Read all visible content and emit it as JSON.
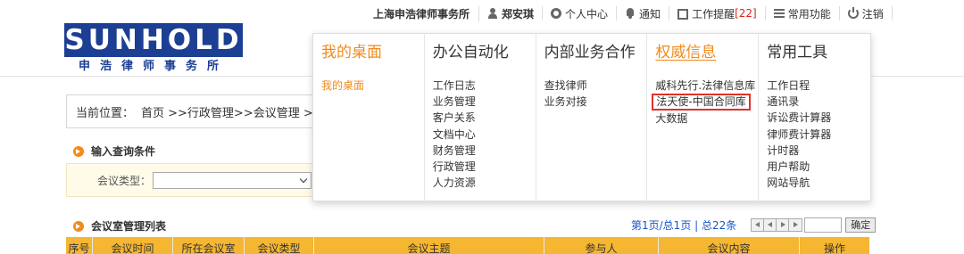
{
  "header": {
    "logo_text": "SUNHOLD",
    "logo_sub": "申浩律师事务所",
    "firm": "上海申浩律师事务所",
    "user": "郑安琪",
    "personal_center": "个人中心",
    "notify": "通知",
    "reminder": "工作提醒",
    "reminder_count": "[22]",
    "common_functions": "常用功能",
    "logout": "注销"
  },
  "breadcrumb": {
    "label": "当前位置：",
    "path": "首页 >>行政管理>>会议管理 >>"
  },
  "query": {
    "title": "输入查询条件",
    "type_label": "会议类型：",
    "type_value": ""
  },
  "list": {
    "title": "会议室管理列表",
    "pager_text": "第1页/总1页 | 总22条",
    "go_label": "确定",
    "columns": [
      "序号",
      "会议时间",
      "所在会议室",
      "会议类型",
      "会议主题",
      "参与人",
      "会议内容",
      "操作"
    ]
  },
  "menu": {
    "columns": [
      {
        "title": "我的桌面",
        "items": [
          "我的桌面"
        ]
      },
      {
        "title": "办公自动化",
        "items": [
          "工作日志",
          "业务管理",
          "客户关系",
          "文档中心",
          "财务管理",
          "行政管理",
          "人力资源"
        ]
      },
      {
        "title": "内部业务合作",
        "items": [
          "查找律师",
          "业务对接"
        ]
      },
      {
        "title": "权威信息",
        "items": [
          "威科先行.法律信息库",
          "法天使-中国合同库",
          "大数据"
        ]
      },
      {
        "title": "常用工具",
        "items": [
          "工作日程",
          "通讯录",
          "诉讼费计算器",
          "律师费计算器",
          "计时器",
          "用户帮助",
          "网站导航"
        ]
      }
    ]
  },
  "colors": {
    "brand_blue": "#1c3f94",
    "accent_orange": "#f08b1c",
    "table_header": "#f5b632",
    "highlight_red": "#e0312a",
    "link_blue": "#1a56c8"
  }
}
